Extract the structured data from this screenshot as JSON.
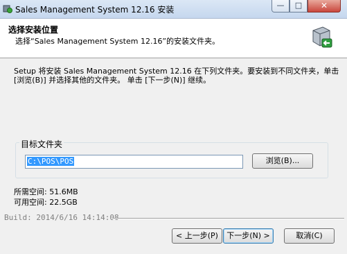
{
  "window": {
    "title": "Sales Management System 12.16 安装",
    "minimize_glyph": "—",
    "maximize_glyph": "□",
    "close_glyph": "✕"
  },
  "header": {
    "title": "选择安装位置",
    "subtitle": "选择“Sales Management System 12.16”的安装文件夹。",
    "icon": "installer-disk-icon"
  },
  "description": "Setup 将安装 Sales Management System 12.16 在下列文件夹。要安装到不同文件夹，单击 [浏览(B)] 并选择其他的文件夹。 单击 [下一步(N)] 继续。",
  "destination": {
    "group_label": "目标文件夹",
    "path_value": "C:\\POS\\POS",
    "browse_label": "浏览(B)..."
  },
  "space": {
    "required": "所需空间: 51.6MB",
    "available": "可用空间: 22.5GB"
  },
  "build": "Build: 2014/6/16 14:14:08",
  "buttons": {
    "back": "< 上一步(P)",
    "next": "下一步(N) >",
    "cancel": "取消(C)"
  }
}
